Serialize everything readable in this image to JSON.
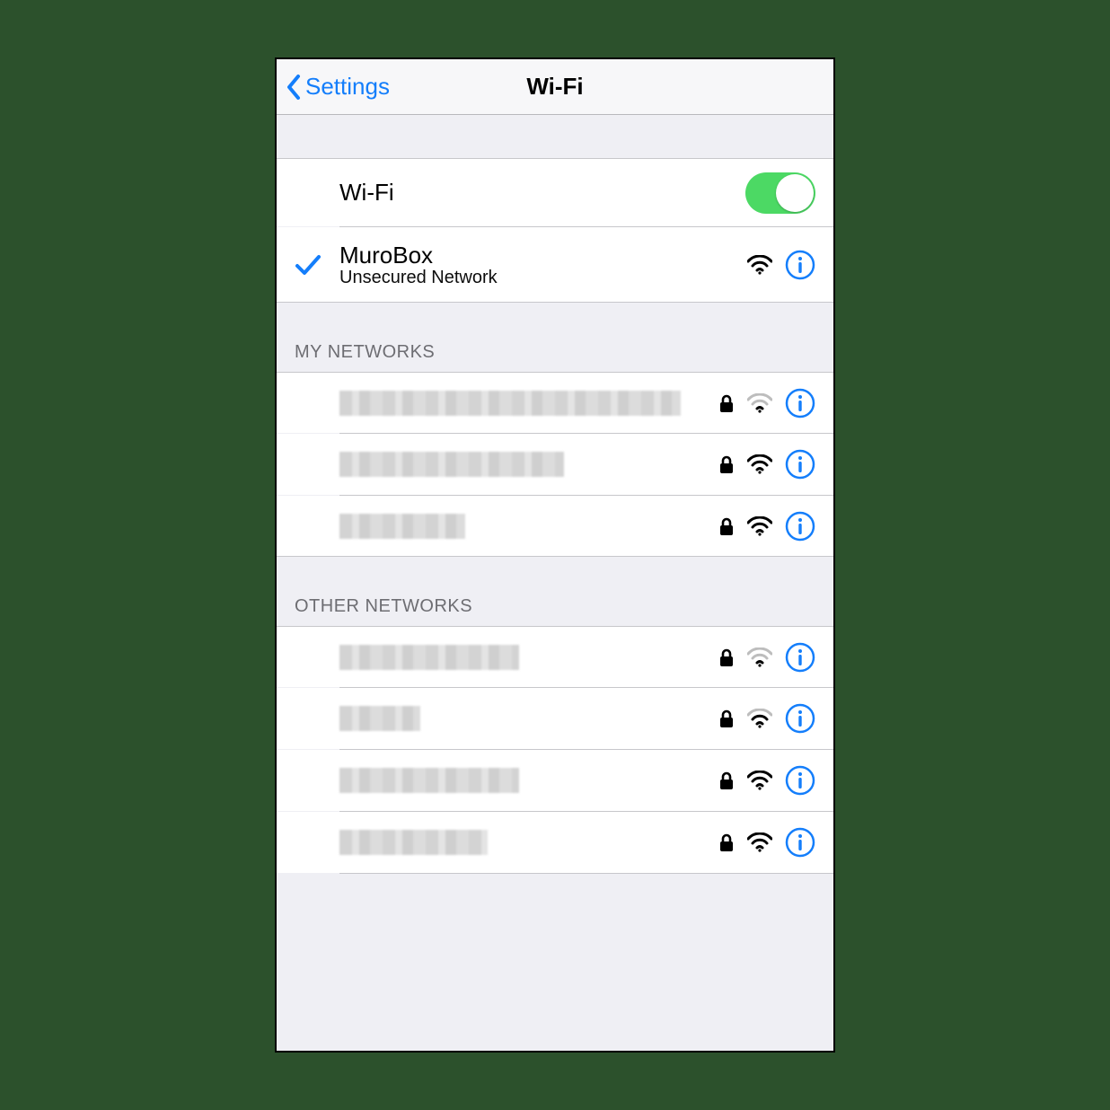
{
  "navbar": {
    "back_label": "Settings",
    "title": "Wi-Fi"
  },
  "wifi_row": {
    "label": "Wi-Fi",
    "enabled": true
  },
  "connected": {
    "name": "MuroBox",
    "subtitle": "Unsecured Network",
    "secured": false,
    "signal": "strong"
  },
  "sections": {
    "my_networks_header": "MY NETWORKS",
    "other_networks_header": "OTHER NETWORKS"
  },
  "my_networks": [
    {
      "secured": true,
      "signal": "weak"
    },
    {
      "secured": true,
      "signal": "strong"
    },
    {
      "secured": true,
      "signal": "strong"
    }
  ],
  "other_networks": [
    {
      "secured": true,
      "signal": "weak"
    },
    {
      "secured": true,
      "signal": "medium"
    },
    {
      "secured": true,
      "signal": "strong"
    },
    {
      "secured": true,
      "signal": "strong"
    }
  ],
  "colors": {
    "accent": "#147efb",
    "toggle_on": "#4cd964"
  }
}
